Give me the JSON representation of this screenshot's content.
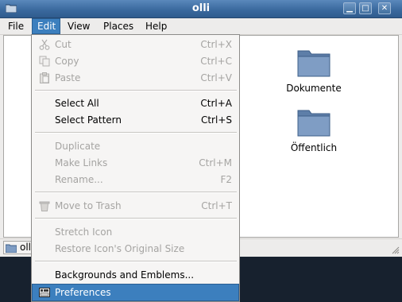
{
  "window": {
    "title": "olli",
    "minimize_glyph": "▁",
    "maximize_glyph": "□",
    "close_glyph": "✕"
  },
  "menubar": {
    "file": "File",
    "edit": "Edit",
    "view": "View",
    "places": "Places",
    "help": "Help"
  },
  "folders": [
    {
      "label": "Dokumente",
      "icon": "folder-icon"
    },
    {
      "label": "Öffentlich",
      "icon": "folder-icon"
    }
  ],
  "statusbar": {
    "location": "olli"
  },
  "edit_menu": {
    "items": [
      {
        "label": "Cut",
        "accel": "Ctrl+X",
        "enabled": false,
        "icon": "scissors-icon"
      },
      {
        "label": "Copy",
        "accel": "Ctrl+C",
        "enabled": false,
        "icon": "copy-icon"
      },
      {
        "label": "Paste",
        "accel": "Ctrl+V",
        "enabled": false,
        "icon": "clipboard-icon"
      },
      {
        "label": "Select All",
        "accel": "Ctrl+A",
        "enabled": true
      },
      {
        "label": "Select Pattern",
        "accel": "Ctrl+S",
        "enabled": true
      },
      {
        "label": "Duplicate",
        "accel": "",
        "enabled": false
      },
      {
        "label": "Make Links",
        "accel": "Ctrl+M",
        "enabled": false
      },
      {
        "label": "Rename...",
        "accel": "F2",
        "enabled": false
      },
      {
        "label": "Move to Trash",
        "accel": "Ctrl+T",
        "enabled": false,
        "icon": "trash-icon"
      },
      {
        "label": "Stretch Icon",
        "accel": "",
        "enabled": false
      },
      {
        "label": "Restore Icon's Original Size",
        "accel": "",
        "enabled": false
      },
      {
        "label": "Backgrounds and Emblems...",
        "accel": "",
        "enabled": true
      },
      {
        "label": "Preferences",
        "accel": "",
        "enabled": true,
        "highlighted": true,
        "icon": "preferences-icon"
      }
    ]
  },
  "colors": {
    "titlebar": "#3b6a9f",
    "highlight": "#3c7fbe",
    "folder": "#6f8fb8",
    "disabled_text": "#a5a4a2"
  }
}
